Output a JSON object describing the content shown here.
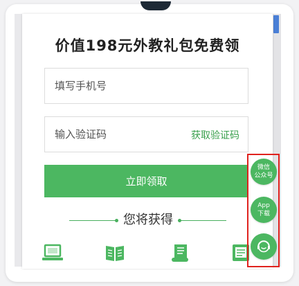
{
  "form": {
    "title": "价值198元外教礼包免费领",
    "phone_placeholder": "填写手机号",
    "code_placeholder": "输入验证码",
    "get_code_label": "获取验证码",
    "submit_label": "立即领取",
    "gain_label": "您将获得"
  },
  "side_buttons": [
    {
      "line1": "微信",
      "line2": "公众号"
    },
    {
      "line1": "App",
      "line2": "下载"
    },
    {
      "icon": "customer-service-icon"
    }
  ],
  "benefit_icons": [
    "laptop-icon",
    "book-icon",
    "certificate-icon",
    "tablet-icon"
  ],
  "colors": {
    "accent": "#4cb761",
    "highlight": "#e0221e",
    "scrollbar": "#4a7fd6"
  }
}
